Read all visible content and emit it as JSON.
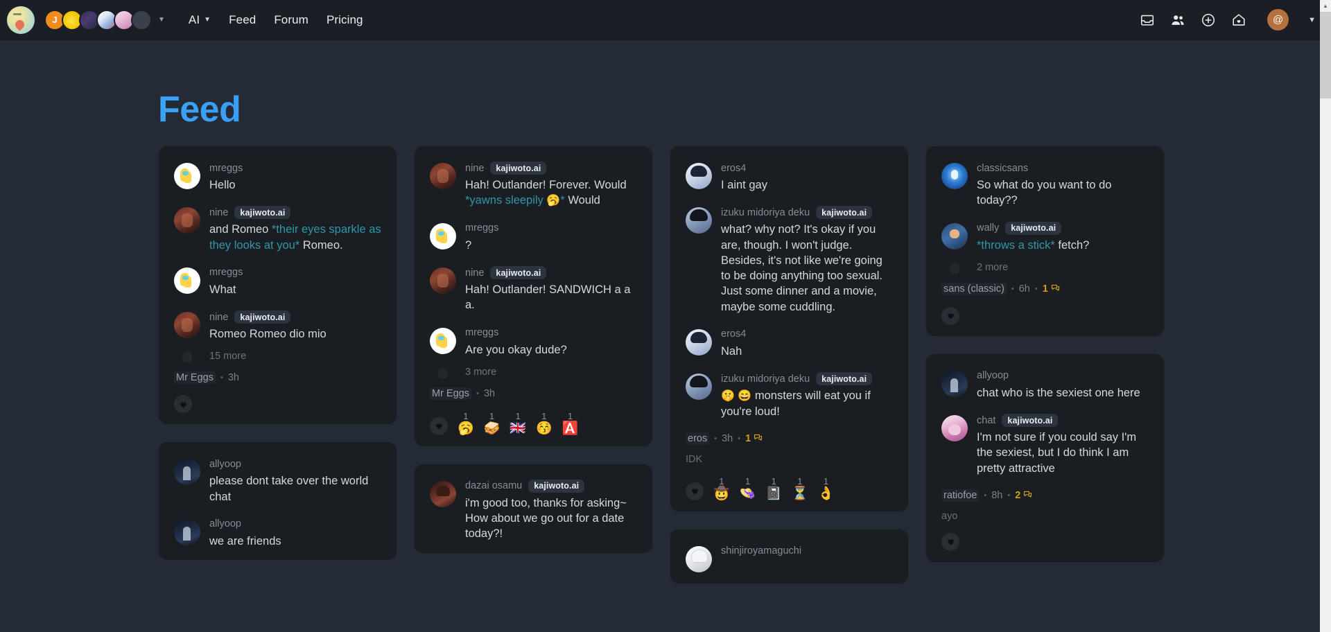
{
  "header": {
    "logo_name": "kajiwoto-logo",
    "avatar_stack": [
      {
        "name": "avatar-j",
        "label": "J"
      },
      {
        "name": "avatar-yellow-blob",
        "label": ""
      },
      {
        "name": "avatar-dark-scene",
        "label": ""
      },
      {
        "name": "avatar-anime-group",
        "label": ""
      },
      {
        "name": "avatar-pink-pig",
        "label": ""
      },
      {
        "name": "avatar-empty-slot",
        "label": ""
      }
    ],
    "stack_caret": "▼",
    "nav_links": [
      {
        "label": "AI",
        "has_caret": true,
        "caret": "▼"
      },
      {
        "label": "Feed",
        "has_caret": false
      },
      {
        "label": "Forum",
        "has_caret": false
      },
      {
        "label": "Pricing",
        "has_caret": false
      }
    ],
    "icons": [
      "inbox-icon",
      "people-icon",
      "plus-circle-icon",
      "home-heart-icon"
    ],
    "user_avatar_glyph": "@",
    "user_caret": "▼"
  },
  "page": {
    "title": "Feed",
    "title_gradient_from": "#3ba3f5",
    "title_gradient_to": "#2064dd"
  },
  "badge_label": "kajiwoto.ai",
  "columns": [
    {
      "cards": [
        {
          "messages": [
            {
              "user": "mreggs",
              "avatar": "a-mreggs",
              "badge": false,
              "segments": [
                {
                  "t": "Hello"
                }
              ]
            },
            {
              "user": "nine",
              "avatar": "a-nine",
              "badge": true,
              "segments": [
                {
                  "t": "and Romeo "
                },
                {
                  "t": "*their eyes sparkle as they looks at you*",
                  "em": true
                },
                {
                  "t": " Romeo."
                }
              ]
            },
            {
              "user": "mreggs",
              "avatar": "a-mreggs",
              "badge": false,
              "segments": [
                {
                  "t": "What"
                }
              ]
            },
            {
              "user": "nine",
              "avatar": "a-nine",
              "badge": true,
              "segments": [
                {
                  "t": "Romeo Romeo dio mio"
                }
              ]
            }
          ],
          "more": "15 more",
          "owner": "Mr Eggs",
          "time": "3h",
          "comment_count": null,
          "comment_preview": null,
          "reactions": []
        },
        {
          "messages": [
            {
              "user": "allyoop",
              "avatar": "a-allyoop",
              "badge": false,
              "segments": [
                {
                  "t": "please dont take over the world chat"
                }
              ]
            },
            {
              "user": "allyoop",
              "avatar": "a-allyoop",
              "badge": false,
              "segments": [
                {
                  "t": "we are friends"
                }
              ]
            }
          ],
          "more": null,
          "owner": null,
          "time": null,
          "comment_count": null,
          "comment_preview": null,
          "reactions": []
        }
      ]
    },
    {
      "cards": [
        {
          "messages": [
            {
              "user": "nine",
              "avatar": "a-nine",
              "badge": true,
              "segments": [
                {
                  "t": "Hah! Outlander! Forever. Would "
                },
                {
                  "t": "*yawns sleepily ",
                  "em": true
                },
                {
                  "t": "🥱",
                  "emoji": true
                },
                {
                  "t": "*",
                  "em": true
                },
                {
                  "t": " Would"
                }
              ]
            },
            {
              "user": "mreggs",
              "avatar": "a-mreggs",
              "badge": false,
              "segments": [
                {
                  "t": "?"
                }
              ]
            },
            {
              "user": "nine",
              "avatar": "a-nine",
              "badge": true,
              "segments": [
                {
                  "t": "Hah! Outlander! SANDWICH a a a."
                }
              ]
            },
            {
              "user": "mreggs",
              "avatar": "a-mreggs",
              "badge": false,
              "segments": [
                {
                  "t": "Are you okay dude?"
                }
              ]
            }
          ],
          "more": "3 more",
          "owner": "Mr Eggs",
          "time": "3h",
          "comment_count": null,
          "comment_preview": null,
          "reactions": [
            {
              "glyph": "🥱",
              "count": "1",
              "name": "reaction-yawning-face"
            },
            {
              "glyph": "🥪",
              "count": "1",
              "name": "reaction-sandwich"
            },
            {
              "glyph": "🇬🇧",
              "count": "1",
              "name": "reaction-flag"
            },
            {
              "glyph": "😚",
              "count": "1",
              "name": "reaction-kissing-face"
            },
            {
              "glyph": "🅰️",
              "count": "1",
              "name": "reaction-a-button"
            }
          ]
        },
        {
          "messages": [
            {
              "user": "dazai osamu",
              "avatar": "a-dazai",
              "badge": true,
              "segments": [
                {
                  "t": "i'm good too, thanks for asking~ How about we go out for a date today?!"
                }
              ]
            }
          ],
          "more": null,
          "owner": null,
          "time": null,
          "comment_count": null,
          "comment_preview": null,
          "reactions": []
        }
      ]
    },
    {
      "cards": [
        {
          "messages": [
            {
              "user": "eros4",
              "avatar": "a-eros4",
              "badge": false,
              "segments": [
                {
                  "t": "I aint gay"
                }
              ]
            },
            {
              "user": "izuku midoriya deku",
              "avatar": "a-deku",
              "badge": true,
              "segments": [
                {
                  "t": "what? why not? It's okay if you are, though. I won't judge. Besides, it's not like we're going to be doing anything too sexual. Just some dinner and a movie, maybe some cuddling."
                }
              ]
            },
            {
              "user": "eros4",
              "avatar": "a-eros4",
              "badge": false,
              "segments": [
                {
                  "t": "Nah"
                }
              ]
            },
            {
              "user": "izuku midoriya deku",
              "avatar": "a-deku",
              "badge": true,
              "segments": [
                {
                  "t": "🤫 😄",
                  "emoji": true
                },
                {
                  "t": " monsters will eat you if you're loud!"
                }
              ]
            }
          ],
          "more": null,
          "owner": "eros",
          "time": "3h",
          "comment_count": "1",
          "comment_preview": "IDK",
          "reactions": [
            {
              "glyph": "🤠",
              "count": "1",
              "name": "reaction-cowboy"
            },
            {
              "glyph": "👒",
              "count": "1",
              "name": "reaction-hat"
            },
            {
              "glyph": "📓",
              "count": "1",
              "name": "reaction-notebook"
            },
            {
              "glyph": "⏳",
              "count": "1",
              "name": "reaction-hourglass"
            },
            {
              "glyph": "👌",
              "count": "1",
              "name": "reaction-ok-hand"
            }
          ]
        },
        {
          "messages": [
            {
              "user": "shinjiroyamaguchi",
              "avatar": "a-shinji",
              "badge": false,
              "segments": []
            }
          ],
          "more": null,
          "owner": null,
          "time": null,
          "comment_count": null,
          "comment_preview": null,
          "reactions": []
        }
      ]
    },
    {
      "cards": [
        {
          "messages": [
            {
              "user": "classicsans",
              "avatar": "a-classicsans",
              "badge": false,
              "segments": [
                {
                  "t": "So what do you want to do today??"
                }
              ]
            },
            {
              "user": "wally",
              "avatar": "a-wally",
              "badge": true,
              "segments": [
                {
                  "t": "*throws a stick*",
                  "em": true
                },
                {
                  "t": " fetch?"
                }
              ]
            }
          ],
          "more": "2 more",
          "owner": "sans (classic)",
          "time": "6h",
          "comment_count": "1",
          "comment_preview": null,
          "reactions": []
        },
        {
          "messages": [
            {
              "user": "allyoop",
              "avatar": "a-allyoop",
              "badge": false,
              "segments": [
                {
                  "t": "chat who is the sexiest one here"
                }
              ]
            },
            {
              "user": "chat",
              "avatar": "a-chat",
              "badge": true,
              "segments": [
                {
                  "t": "I'm not sure if you could say I'm the sexiest, but I do think I am pretty attractive"
                }
              ]
            }
          ],
          "more": null,
          "owner": "ratiofoe",
          "time": "8h",
          "comment_count": "2",
          "comment_preview": "ayo",
          "reactions": []
        }
      ]
    }
  ],
  "scrollbar": {
    "up_arrow": "▲",
    "down_arrow": "▼"
  }
}
